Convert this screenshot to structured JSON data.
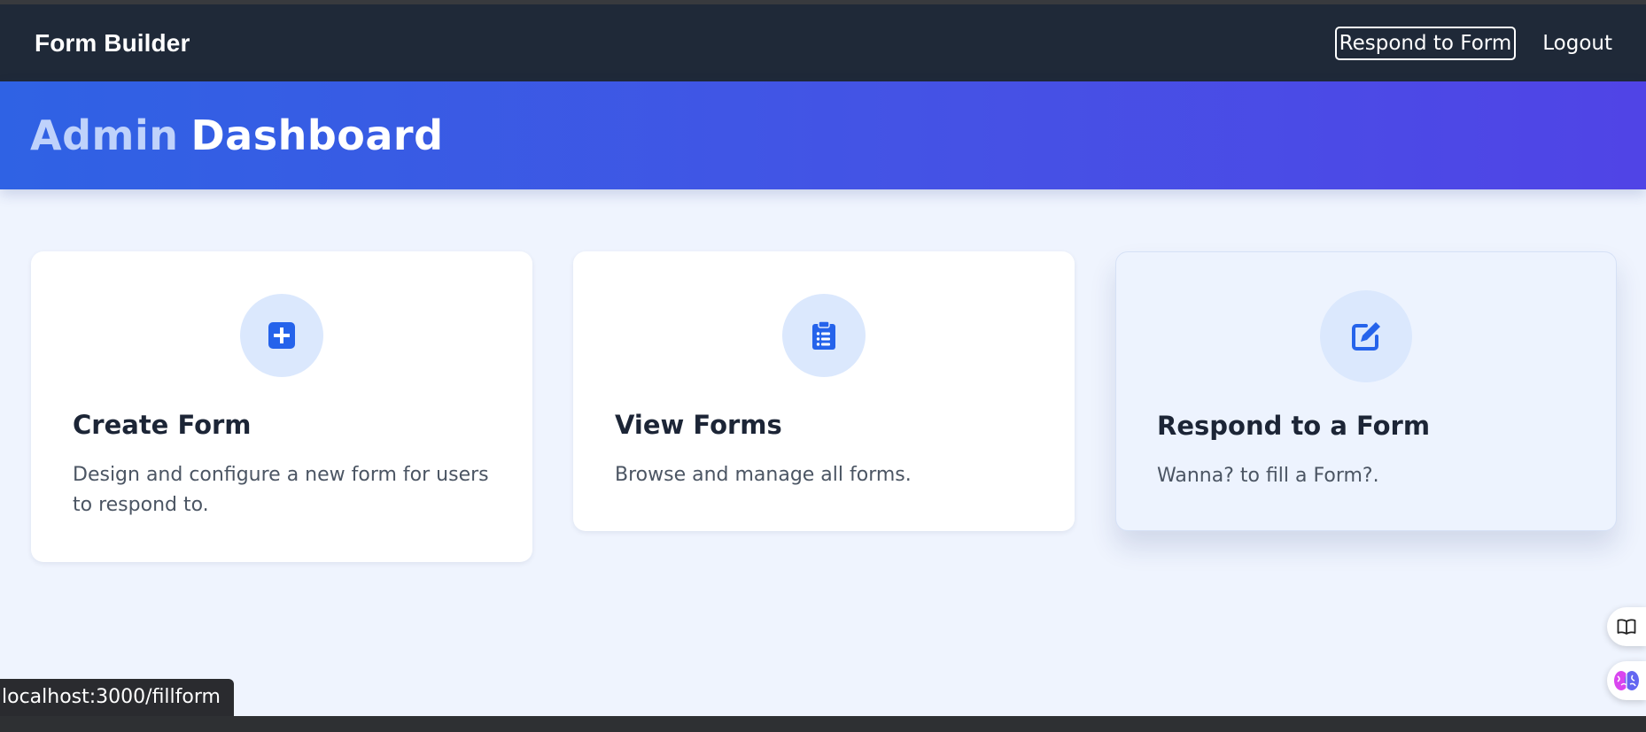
{
  "navbar": {
    "brand": "Form Builder",
    "respond_button": "Respond to Form",
    "logout": "Logout"
  },
  "hero": {
    "title_word1": "Admin",
    "title_word2": "Dashboard"
  },
  "cards": [
    {
      "icon": "plus-square-icon",
      "title": "Create Form",
      "description": "Design and configure a new form for users to respond to."
    },
    {
      "icon": "clipboard-list-icon",
      "title": "View Forms",
      "description": "Browse and manage all forms."
    },
    {
      "icon": "edit-square-icon",
      "title": "Respond to a Form",
      "description": "Wanna? to fill a Form?."
    }
  ],
  "status_bar": {
    "url": "localhost:3000/fillform"
  },
  "side_buttons": [
    {
      "icon": "book-icon"
    },
    {
      "icon": "brain-icon"
    }
  ],
  "colors": {
    "navbar_bg": "#1f2938",
    "accent": "#2563eb",
    "hero_gradient_start": "#2f62e4",
    "hero_gradient_end": "#5044e6",
    "page_bg": "#eff4fe"
  }
}
